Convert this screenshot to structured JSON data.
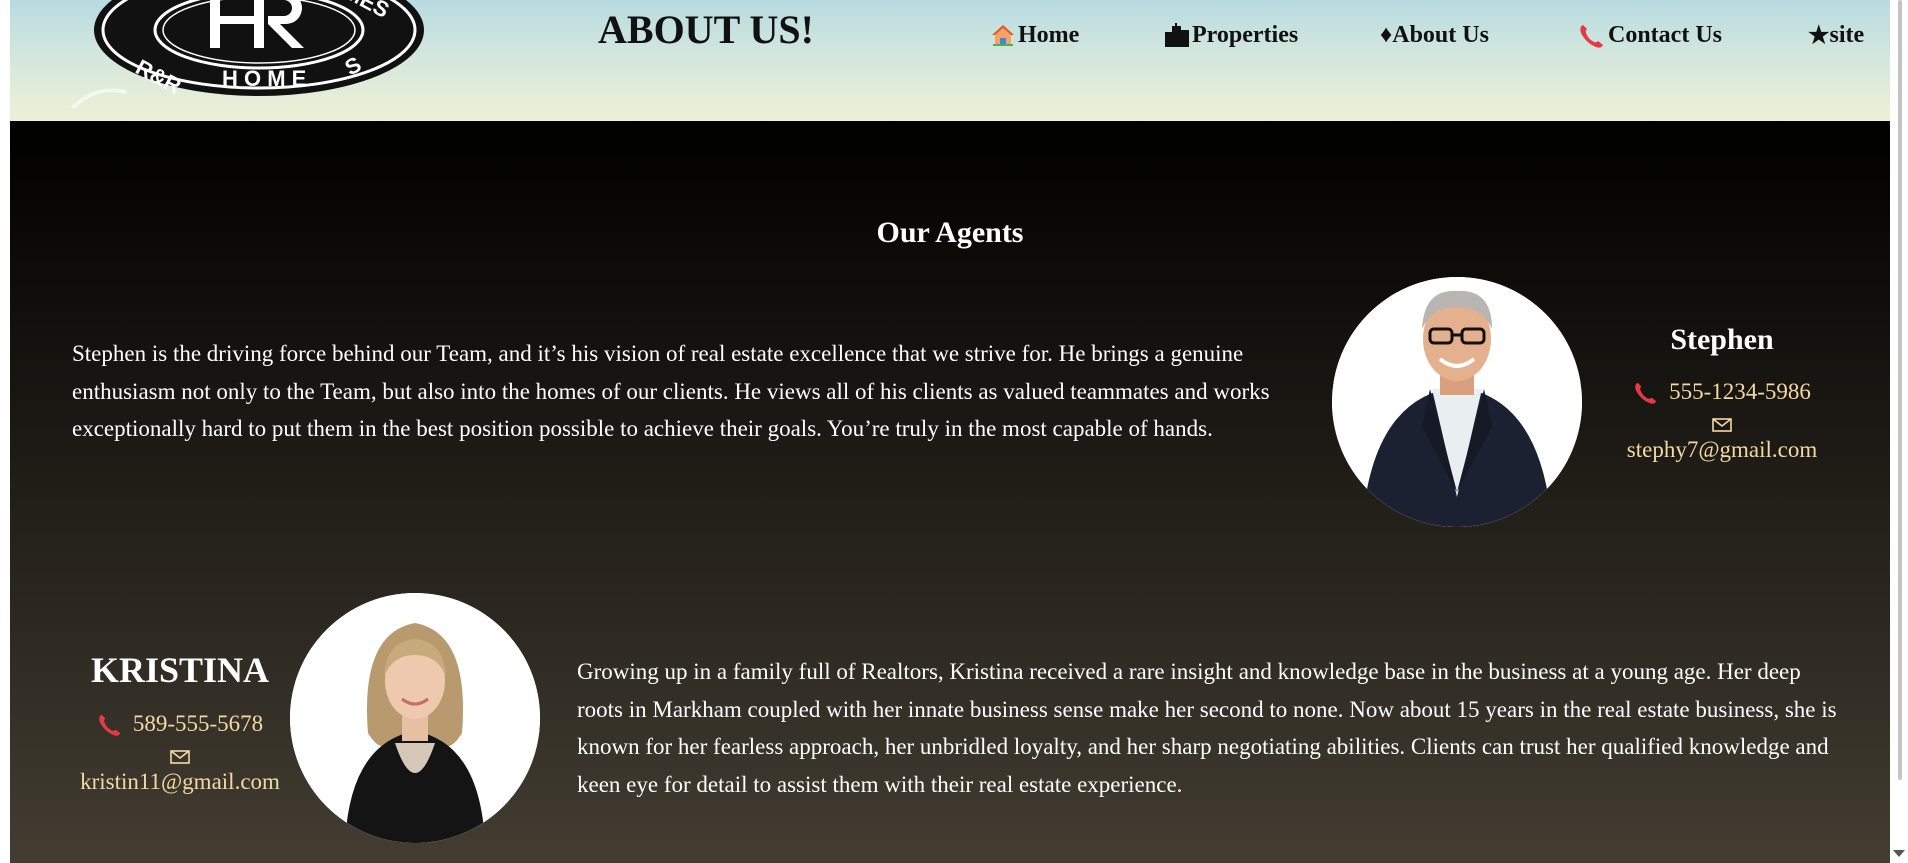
{
  "header": {
    "logo": {
      "text_top": "R&R HOMES",
      "text_bottom": "R&R HOMES",
      "monogram": "R"
    },
    "page_heading": "ABOUT US!",
    "nav": [
      {
        "label": "Home",
        "icon": "house-icon"
      },
      {
        "label": "Properties",
        "icon": "buildings-icon"
      },
      {
        "label": "About Us",
        "icon": "diamond-icon",
        "prefix": "♦"
      },
      {
        "label": "Contact Us",
        "icon": "phone-icon"
      },
      {
        "label": "site",
        "icon": "star-icon",
        "prefix": "★"
      }
    ]
  },
  "main": {
    "section_title": "Our Agents",
    "agents": [
      {
        "name": "Stephen",
        "phone": "555-1234-5986",
        "email": "stephy7@gmail.com",
        "bio": "Stephen is the driving force behind our Team, and it’s his vision of real estate excellence that we strive for. He brings a genuine enthusiasm not only to the Team, but also into the homes of our clients. He views all of his clients as valued teammates and works exceptionally hard to put them in the best position possible to achieve their goals. You’re truly in the most capable of hands."
      },
      {
        "name": "KRISTINA",
        "phone": "589-555-5678",
        "email": "kristin11@gmail.com",
        "bio": "Growing up in a family full of Realtors, Kristina received a rare insight and knowledge base in the business at a young age. Her deep roots in Markham coupled with her innate business sense make her second to none. Now about 15 years in the real estate business, she is known for her fearless approach, her unbridled loyalty, and her sharp negotiating abilities. Clients can trust her qualified knowledge and keen eye for detail to assist them with their real estate experience."
      }
    ]
  },
  "colors": {
    "header_top": "#b7dbe2",
    "header_bottom": "#edf1d6",
    "main_top": "#000000",
    "main_bottom": "#433d32",
    "contact_text": "#f4d9a4",
    "phone_icon": "#e53945"
  }
}
